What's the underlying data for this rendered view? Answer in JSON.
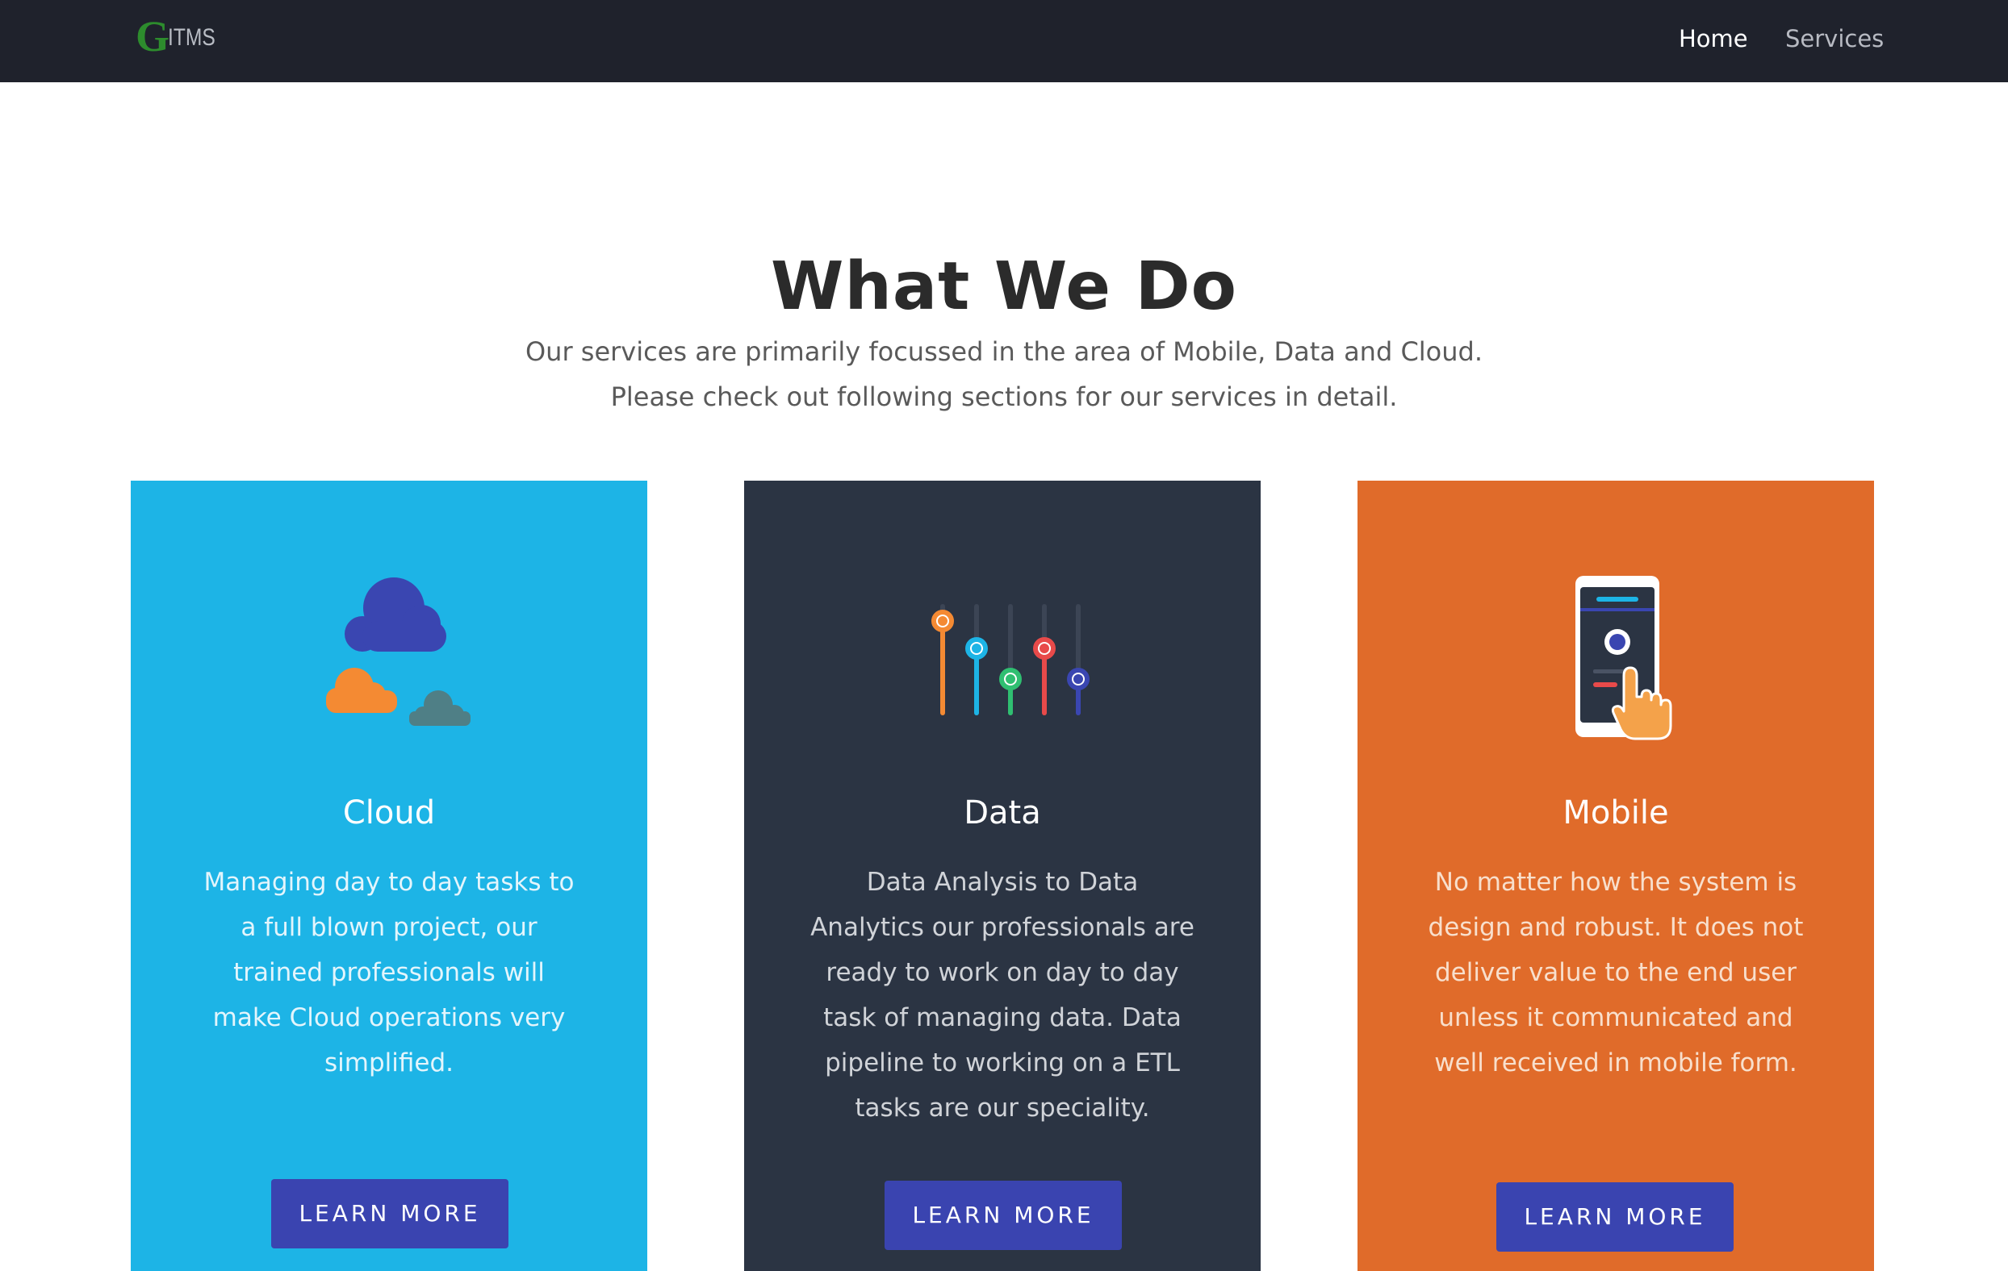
{
  "nav": {
    "logo_g": "G",
    "logo_text": "ITMS",
    "links": [
      {
        "label": "Home"
      },
      {
        "label": "Services"
      }
    ]
  },
  "header": {
    "title": "What We Do",
    "subtitle": "Our services are primarily focussed in the area of Mobile, Data and Cloud. Please check out following sections for our services in detail."
  },
  "cards": [
    {
      "title": "Cloud",
      "text": "Managing day to day tasks to a full blown project, our trained professionals will make Cloud operations very simplified.",
      "button": "LEARN MORE",
      "icon": "clouds-icon",
      "color": "#1db4e6"
    },
    {
      "title": "Data",
      "text": "Data Analysis to Data Analytics our professionals are ready to work on day to day task of managing data. Data pipeline to working on a ETL tasks are our speciality.",
      "button": "LEARN MORE",
      "icon": "equalizer-sliders-icon",
      "color": "#2b3443"
    },
    {
      "title": "Mobile",
      "text": "No matter how the system is design and robust. It does not deliver value to the end user unless it communicated and well received in mobile form.",
      "button": "LEARN MORE",
      "icon": "mobile-tap-icon",
      "color": "#e06b2a"
    }
  ],
  "colors": {
    "navbar": "#1f222c",
    "button": "#3a44b0",
    "logo_green": "#2d8c2d"
  }
}
